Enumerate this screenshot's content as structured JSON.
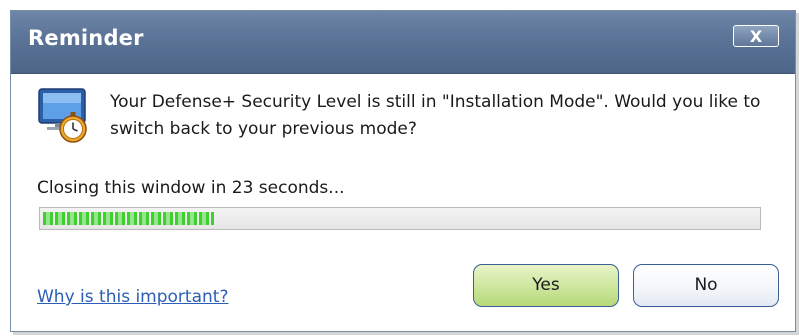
{
  "dialog": {
    "title": "Reminder",
    "close_label": "X",
    "message": "Your Defense+ Security Level is still in \"Installation Mode\". Would you like to switch back to your previous mode?",
    "countdown_text": "Closing this window in 23 seconds...",
    "progress_fraction": 0.24,
    "link_text": "Why is this important?",
    "yes_label": "Yes",
    "no_label": "No",
    "icon": "monitor-stopwatch-icon"
  },
  "colors": {
    "titlebar": "#5a7396",
    "progress_green": "#3fcf2f",
    "link": "#2a5fb5",
    "yes_button": "#cfe7a0"
  }
}
